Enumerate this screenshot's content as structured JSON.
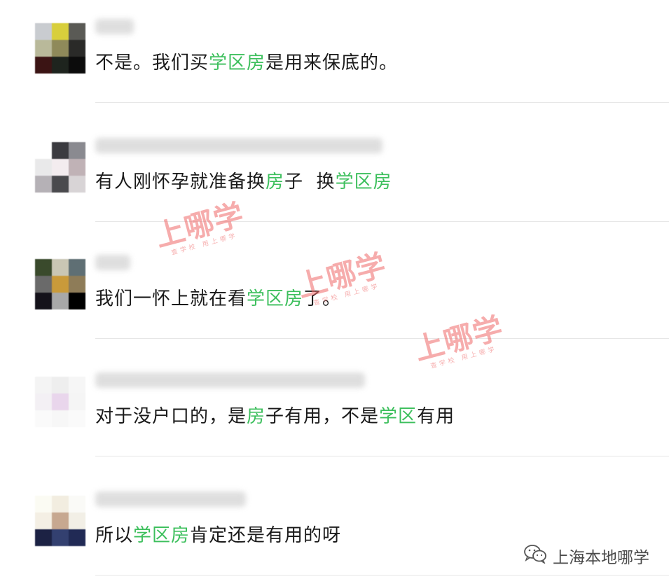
{
  "comments": [
    {
      "avatar_colors": [
        "#c9ccd0",
        "#d8cf3c",
        "#5a5a55",
        "#b9b99a",
        "#8f8a5a",
        "#2a2a28",
        "#3b1414",
        "#1e241e",
        "#0c0c0c"
      ],
      "segments": [
        {
          "t": "不是。我们买",
          "kw": false
        },
        {
          "t": "学区房",
          "kw": true
        },
        {
          "t": "是用来保底的。",
          "kw": false
        }
      ]
    },
    {
      "avatar_colors": [
        "#ffffff",
        "#3b3b40",
        "#8a8a90",
        "#e9e9ea",
        "#f3ecef",
        "#c0b2b6",
        "#b5b1b6",
        "#4a4a4e",
        "#d8d4d6"
      ],
      "segments": [
        {
          "t": "有人刚怀孕就准备换",
          "kw": false
        },
        {
          "t": "房",
          "kw": true
        },
        {
          "t": "子  换",
          "kw": false
        },
        {
          "t": "学区房",
          "kw": true
        }
      ]
    },
    {
      "avatar_colors": [
        "#3a4a2c",
        "#c9c6b4",
        "#5f6f74",
        "#6a6a6a",
        "#c99a3a",
        "#8e7c58",
        "#14121a",
        "#a8a8a8",
        "#000000"
      ],
      "segments": [
        {
          "t": "我们一怀上就在看",
          "kw": false
        },
        {
          "t": "学区房",
          "kw": true
        },
        {
          "t": "了。",
          "kw": false
        }
      ]
    },
    {
      "avatar_colors": [
        "#f4f4f4",
        "#eeeeee",
        "#f6f6f6",
        "#f3f0f4",
        "#e9d6ec",
        "#f5f5f5",
        "#fafafa",
        "#f7f7f7",
        "#fafafa"
      ],
      "segments": [
        {
          "t": "对于没户口的，是",
          "kw": false
        },
        {
          "t": "房",
          "kw": true
        },
        {
          "t": "子有用，不是",
          "kw": false
        },
        {
          "t": "学区",
          "kw": true
        },
        {
          "t": "有用",
          "kw": false
        }
      ]
    },
    {
      "avatar_colors": [
        "#fbfbf3",
        "#f2ede0",
        "#fafaf7",
        "#f4efe4",
        "#c7a890",
        "#f2efe6",
        "#1c2244",
        "#334070",
        "#212a55"
      ],
      "segments": [
        {
          "t": "所以",
          "kw": false
        },
        {
          "t": "学区房",
          "kw": true
        },
        {
          "t": "肯定还是有用的呀",
          "kw": false
        }
      ]
    }
  ],
  "watermark": {
    "main": "上哪学",
    "sub": "查学校  用上哪学"
  },
  "brand": {
    "label": "上海本地哪学",
    "icon": "wechat-icon"
  },
  "colors": {
    "keyword": "#3cbf5c",
    "text": "#1a1a1a",
    "watermark": "#f06a6a"
  }
}
